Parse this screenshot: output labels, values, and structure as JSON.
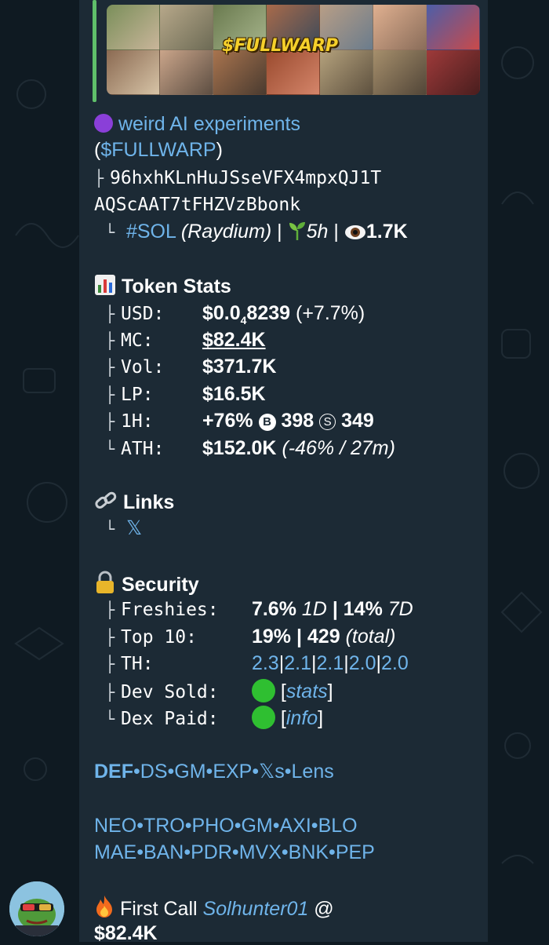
{
  "media": {
    "title": "$FULLWARP"
  },
  "header": {
    "name": "weird AI experiments",
    "ticker_open": "(",
    "ticker": "$FULLWARP",
    "ticker_close": ")",
    "address_1": "96hxhKLnHuJSseVFX4mpxQJ1T",
    "address_2": "AQScAAT7tFHZVzBbonk",
    "chain_tag": "#SOL",
    "dex": "(Raydium)",
    "sep1": "|",
    "age": "5h",
    "sep2": "|",
    "views": "1.7K"
  },
  "token_stats": {
    "heading": "Token Stats",
    "usd_label": "USD:",
    "usd_main": "$0.0",
    "usd_sub": "4",
    "usd_rest": "8239",
    "usd_change": "(+7.7%)",
    "mc_label": "MC:",
    "mc_value": "$82.4K",
    "vol_label": "Vol:",
    "vol_value": "$371.7K",
    "lp_label": "LP:",
    "lp_value": "$16.5K",
    "h1_label": "1H:",
    "h1_change": "+76%",
    "h1_buys_icon": "B",
    "h1_buys": "398",
    "h1_sells_icon": "S",
    "h1_sells": "349",
    "ath_label": "ATH:",
    "ath_value": "$152.0K",
    "ath_change": "(-46% / 27m)"
  },
  "links": {
    "heading": "Links",
    "x_link": "𝕏"
  },
  "security": {
    "heading": "Security",
    "freshies_label": "Freshies:",
    "freshies_1d": "7.6%",
    "freshies_1d_unit": "1D",
    "freshies_sep": "|",
    "freshies_7d": "14%",
    "freshies_7d_unit": "7D",
    "top10_label": "Top 10:",
    "top10_pct": "19%",
    "top10_sep": "|",
    "top10_holders": "429",
    "top10_total": "(total)",
    "th_label": "TH:",
    "th_values": [
      "2.3",
      "2.1",
      "2.1",
      "2.0",
      "2.0"
    ],
    "th_sep": "|",
    "dev_sold_label": "Dev Sold:",
    "dev_sold_link": "stats",
    "dex_paid_label": "Dex Paid:",
    "dex_paid_link": "info"
  },
  "link_rows": {
    "row1": [
      "DEF",
      "DS",
      "GM",
      "EXP",
      "𝕏s",
      "Lens"
    ],
    "row2": [
      "NEO",
      "TRO",
      "PHO",
      "GM",
      "AXI",
      "BLO"
    ],
    "row3": [
      "MAE",
      "BAN",
      "PDR",
      "MVX",
      "BNK",
      "PEP"
    ],
    "sep": "•"
  },
  "first_call": {
    "label": "First Call",
    "user": "Solhunter01",
    "at": "@",
    "value": "$82.4K"
  },
  "colors": {
    "background": "#0f1a22",
    "bubble": "#1c2a35",
    "link": "#6fb4ea",
    "accent_bar": "#5fbf6a",
    "status_green": "#2fbf31"
  }
}
